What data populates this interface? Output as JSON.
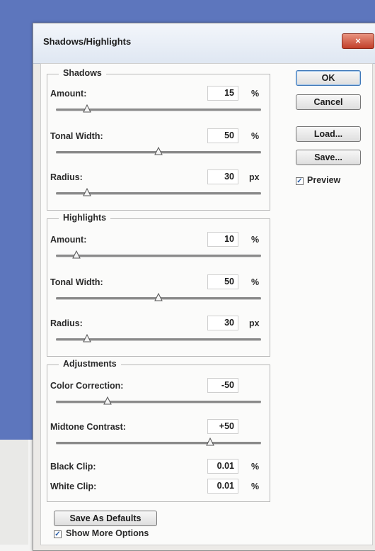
{
  "window": {
    "title": "Shadows/Highlights",
    "close_glyph": "×"
  },
  "sections": [
    {
      "legend": "Shadows",
      "controls": [
        {
          "label": "Amount:",
          "value": "15",
          "unit": "%",
          "slider": 0.15
        },
        {
          "label": "Tonal Width:",
          "value": "50",
          "unit": "%",
          "slider": 0.5
        },
        {
          "label": "Radius:",
          "value": "30",
          "unit": "px",
          "slider": 0.15
        }
      ]
    },
    {
      "legend": "Highlights",
      "controls": [
        {
          "label": "Amount:",
          "value": "10",
          "unit": "%",
          "slider": 0.1
        },
        {
          "label": "Tonal Width:",
          "value": "50",
          "unit": "%",
          "slider": 0.5
        },
        {
          "label": "Radius:",
          "value": "30",
          "unit": "px",
          "slider": 0.15
        }
      ]
    },
    {
      "legend": "Adjustments",
      "controls": [
        {
          "label": "Color Correction:",
          "value": "-50",
          "unit": "",
          "slider": 0.25
        },
        {
          "label": "Midtone Contrast:",
          "value": "+50",
          "unit": "",
          "slider": 0.75
        }
      ],
      "clips": [
        {
          "label": "Black Clip:",
          "value": "0.01",
          "unit": "%"
        },
        {
          "label": "White Clip:",
          "value": "0.01",
          "unit": "%"
        }
      ]
    }
  ],
  "buttons": {
    "ok": "OK",
    "cancel": "Cancel",
    "load": "Load...",
    "save": "Save...",
    "save_defaults": "Save As Defaults"
  },
  "preview": {
    "label": "Preview",
    "checked": true
  },
  "show_more": {
    "label": "Show More Options",
    "checked": true
  },
  "colors": {
    "backdrop": "#5d76bd",
    "dialog": "#eceae7",
    "close": "#c2402a"
  }
}
